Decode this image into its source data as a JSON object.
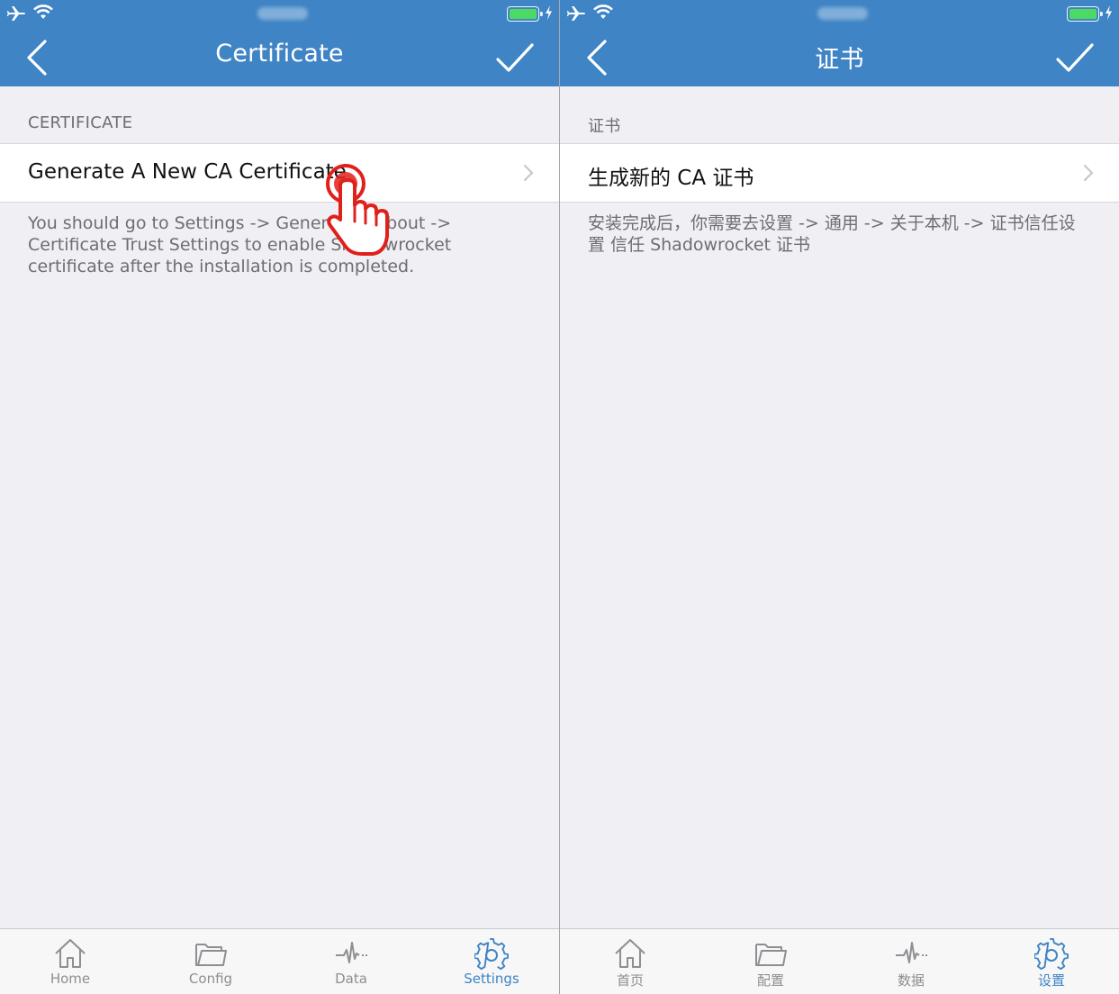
{
  "left": {
    "title": "Certificate",
    "section_header": "CERTIFICATE",
    "cell_label": "Generate A New CA Certificate",
    "footer": "You should go to Settings -> General -> About -> Certificate Trust Settings to enable Shadowrocket certificate after the installation is completed.",
    "tabs": [
      {
        "label": "Home",
        "icon": "home-icon"
      },
      {
        "label": "Config",
        "icon": "folder-icon"
      },
      {
        "label": "Data",
        "icon": "pulse-icon"
      },
      {
        "label": "Settings",
        "icon": "gear-icon",
        "active": true
      }
    ]
  },
  "right": {
    "title": "证书",
    "section_header": "证书",
    "cell_label": "生成新的 CA 证书",
    "footer": "安装完成后，你需要去设置 -> 通用 -> 关于本机 -> 证书信任设置 信任 Shadowrocket 证书",
    "tabs": [
      {
        "label": "首页",
        "icon": "home-icon"
      },
      {
        "label": "配置",
        "icon": "folder-icon"
      },
      {
        "label": "数据",
        "icon": "pulse-icon"
      },
      {
        "label": "设置",
        "icon": "gear-icon",
        "active": true
      }
    ]
  },
  "colors": {
    "nav_bar": "#3f84c5",
    "background": "#efeff4",
    "tab_active": "#3f84c5",
    "tab_inactive": "#8e8e93",
    "tap_indicator": "#e0201b"
  }
}
